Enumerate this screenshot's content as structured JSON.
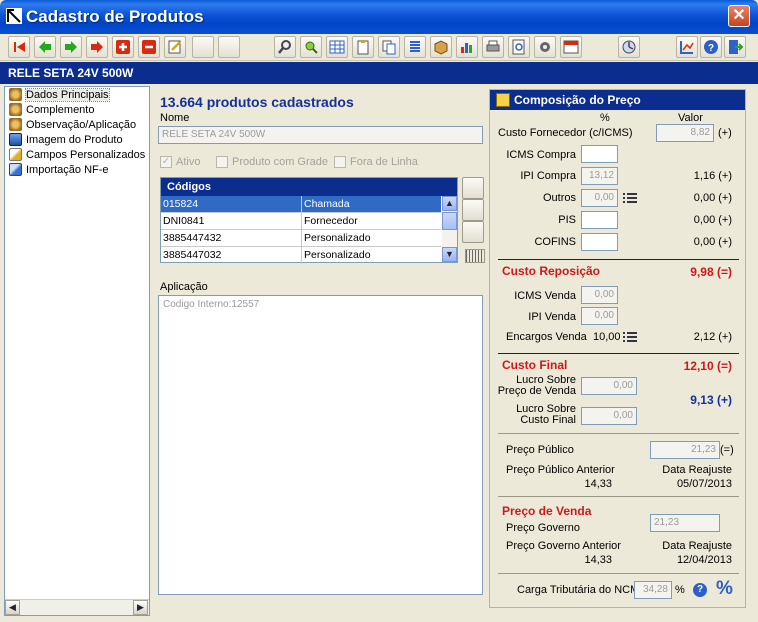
{
  "window": {
    "title": "Cadastro de Produtos",
    "close_glyph": "✕"
  },
  "product_bar": {
    "name": "RELE SETA 24V 500W"
  },
  "tree": {
    "items": [
      {
        "label": "Dados Principais",
        "icon": "gear-icon",
        "color": "#c08a2c"
      },
      {
        "label": "Complemento",
        "icon": "gear-icon",
        "color": "#c08a2c"
      },
      {
        "label": "Observação/Aplicação",
        "icon": "gear-icon",
        "color": "#c08a2c"
      },
      {
        "label": "Imagem do Produto",
        "icon": "picture-icon",
        "color": "#3a6fd0"
      },
      {
        "label": "Campos Personalizados",
        "icon": "edit-icon",
        "color": "#e0b020"
      },
      {
        "label": "Importação NF-e",
        "icon": "import-icon",
        "color": "#3a6fd0"
      }
    ]
  },
  "main": {
    "count_title": "13.664 produtos cadastrados",
    "name_label": "Nome",
    "name_value": "RELE SETA 24V 500W",
    "check_ativo": "Ativo",
    "check_grade": "Produto com Grade",
    "check_fora": "Fora de Linha",
    "codes_header": "Códigos",
    "codes": [
      {
        "code": "015824",
        "type": "Chamada"
      },
      {
        "code": "DNI0841",
        "type": "Fornecedor"
      },
      {
        "code": "3885447432",
        "type": "Personalizado"
      },
      {
        "code": "3885447032",
        "type": "Personalizado"
      }
    ],
    "barcode_caption": "123",
    "aplicacao_label": "Aplicação",
    "aplicacao_value": "Codigo Interno:12557"
  },
  "price": {
    "header": "Composição do Preço",
    "col_pct": "%",
    "col_valor": "Valor",
    "custo_fornecedor_label": "Custo Fornecedor (c/ICMS)",
    "custo_fornecedor_value": "8,82",
    "plus": "(+)",
    "equals": "(=)",
    "icms_compra_label": "ICMS Compra",
    "icms_compra_pct": "",
    "ipi_compra_label": "IPI Compra",
    "ipi_compra_pct": "13,12",
    "ipi_compra_value": "1,16 (+)",
    "outros_label": "Outros",
    "outros_pct": "0,00",
    "outros_value": "0,00 (+)",
    "pis_label": "PIS",
    "pis_value": "0,00 (+)",
    "cofins_label": "COFINS",
    "cofins_value": "0,00 (+)",
    "custo_reposicao_label": "Custo Reposição",
    "custo_reposicao_value": "9,98 (=)",
    "icms_venda_label": "ICMS Venda",
    "icms_venda_pct": "0,00",
    "ipi_venda_label": "IPI Venda",
    "ipi_venda_pct": "0,00",
    "encargos_label": "Encargos Venda",
    "encargos_pct": "10,00",
    "encargos_value": "2,12 (+)",
    "custo_final_label": "Custo Final",
    "custo_final_value": "12,10 (=)",
    "lucro_preco_label_1": "Lucro Sobre",
    "lucro_preco_label_2": "Preço de Venda",
    "lucro_preco_value": "0,00",
    "lucro_custo_label_1": "Lucro Sobre",
    "lucro_custo_label_2": "Custo Final",
    "lucro_custo_value": "0,00",
    "lucro_total": "9,13 (+)",
    "preco_publico_label": "Preço Público",
    "preco_publico_value": "21,23",
    "preco_publico_ant_label": "Preço Público Anterior",
    "preco_publico_ant_value": "14,33",
    "data_reajuste_label": "Data Reajuste",
    "data_reajuste_1": "05/07/2013",
    "preco_venda_label": "Preço de Venda",
    "preco_governo_label": "Preço Governo",
    "preco_governo_value": "21,23",
    "preco_governo_ant_label": "Preço Governo Anterior",
    "preco_governo_ant_value": "14,33",
    "data_reajuste_2": "12/04/2013",
    "carga_label": "Carga Tributária do NCM",
    "carga_value": "34,28",
    "pct_symbol": "%",
    "help_glyph": "?",
    "big_pct": "%"
  },
  "colors": {
    "accent": "#0b2d8e",
    "title_bar": "#0044c8",
    "red_label": "#d01818",
    "blue_label": "#14309c"
  }
}
